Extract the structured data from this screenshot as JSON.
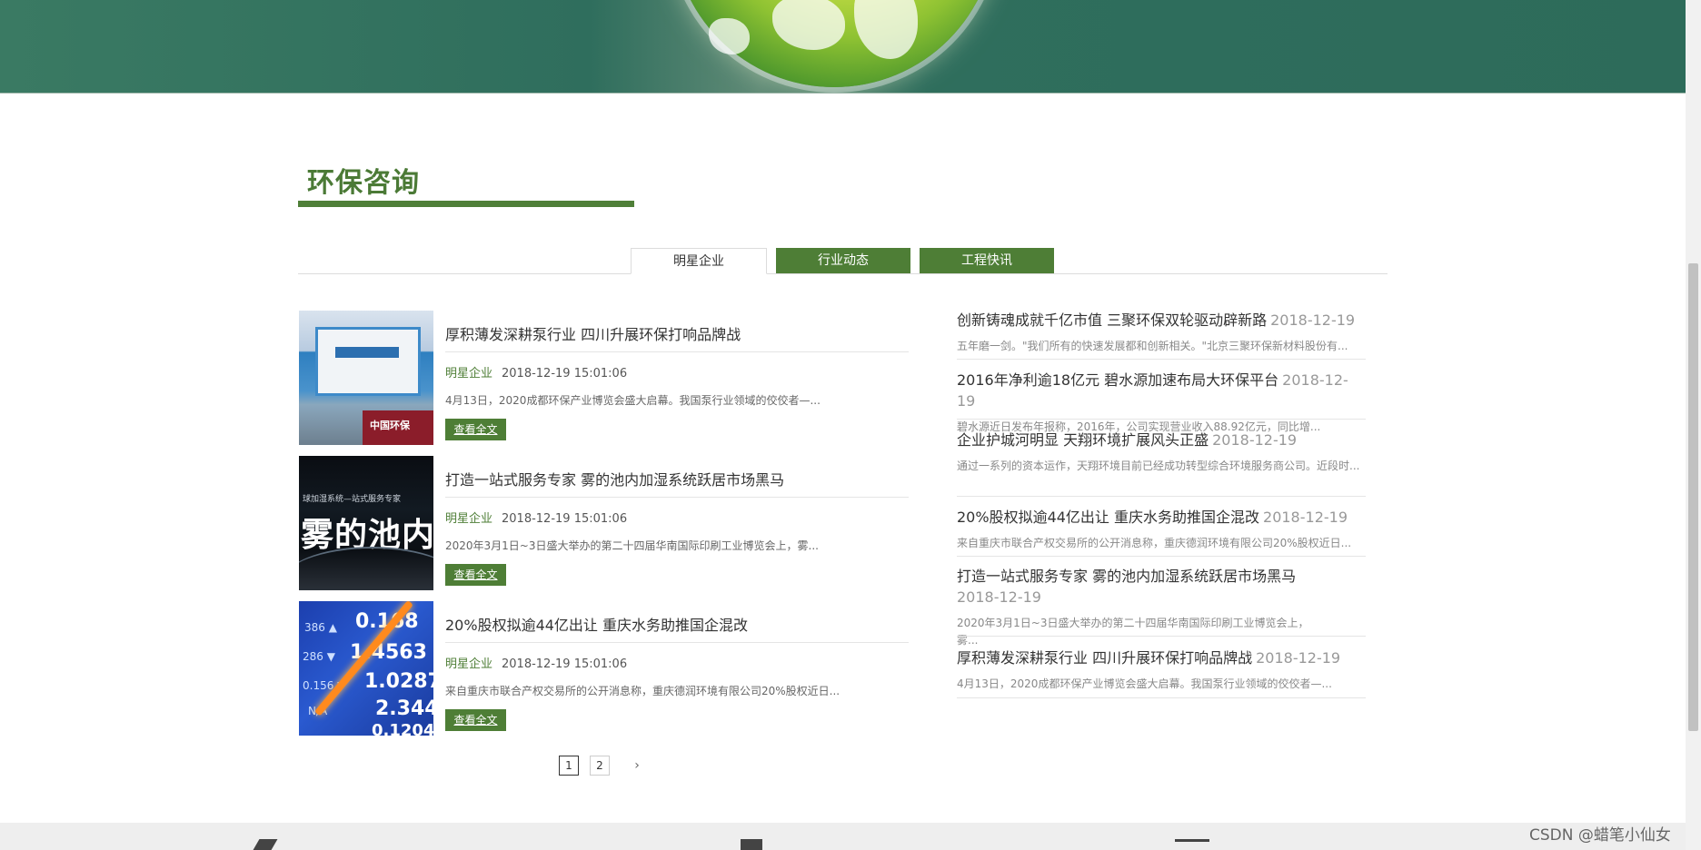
{
  "section": {
    "title": "环保咨询"
  },
  "tabs": [
    {
      "label": "明星企业",
      "active": true
    },
    {
      "label": "行业动态",
      "active": false
    },
    {
      "label": "工程快讯",
      "active": false
    }
  ],
  "news": [
    {
      "title": "厚积薄发深耕泵行业 四川升展环保打响品牌战",
      "category": "明星企业",
      "datetime": "2018-12-19 15:01:06",
      "summary": "4月13日，2020成都环保产业博览会盛大启幕。我国泵行业领域的佼佼者—...",
      "button": "查看全文"
    },
    {
      "title": "打造一站式服务专家 雾的池内加湿系统跃居市场黑马",
      "category": "明星企业",
      "datetime": "2018-12-19 15:01:06",
      "summary": "2020年3月1日~3日盛大举办的第二十四届华南国际印刷工业博览会上，雾...",
      "button": "查看全文"
    },
    {
      "title": "20%股权拟逾44亿出让 重庆水务助推国企混改",
      "category": "明星企业",
      "datetime": "2018-12-19 15:01:06",
      "summary": "来自重庆市联合产权交易所的公开消息称，重庆德润环境有限公司20%股权近日...",
      "button": "查看全文"
    }
  ],
  "thumbs": {
    "t1_watermark": "中国环保",
    "t2_small": "球加湿系统—站式服务专家",
    "t2_big": "雾的池内"
  },
  "side_news": [
    {
      "title": "创新铸魂成就千亿市值 三聚环保双轮驱动辟新路",
      "date": "2018-12-19",
      "summary": "五年磨一剑。\"我们所有的快速发展都和创新相关。\"北京三聚环保新材料股份有..."
    },
    {
      "title": "2016年净利逾18亿元 碧水源加速布局大环保平台",
      "date": "2018-12-19",
      "summary": "碧水源近日发布年报称，2016年，公司实现营业收入88.92亿元，同比增..."
    },
    {
      "title": "企业护城河明显 天翔环境扩展风头正盛",
      "date": "2018-12-19",
      "summary": "通过一系列的资本运作，天翔环境目前已经成功转型综合环境服务商公司。近段时..."
    },
    {
      "title": "20%股权拟逾44亿出让 重庆水务助推国企混改",
      "date": "2018-12-19",
      "summary": "来自重庆市联合产权交易所的公开消息称，重庆德润环境有限公司20%股权近日..."
    },
    {
      "title": "打造一站式服务专家 雾的池内加湿系统跃居市场黑马",
      "date": "2018-12-19",
      "summary": "2020年3月1日~3日盛大举办的第二十四届华南国际印刷工业博览会上，雾..."
    },
    {
      "title": "厚积薄发深耕泵行业 四川升展环保打响品牌战",
      "date": "2018-12-19",
      "summary": "4月13日，2020成都环保产业博览会盛大启幕。我国泵行业领域的佼佼者—..."
    }
  ],
  "pagination": {
    "pages": [
      "1",
      "2"
    ],
    "current": "1",
    "next": "›"
  },
  "watermark": "CSDN @蜡笔小仙女"
}
